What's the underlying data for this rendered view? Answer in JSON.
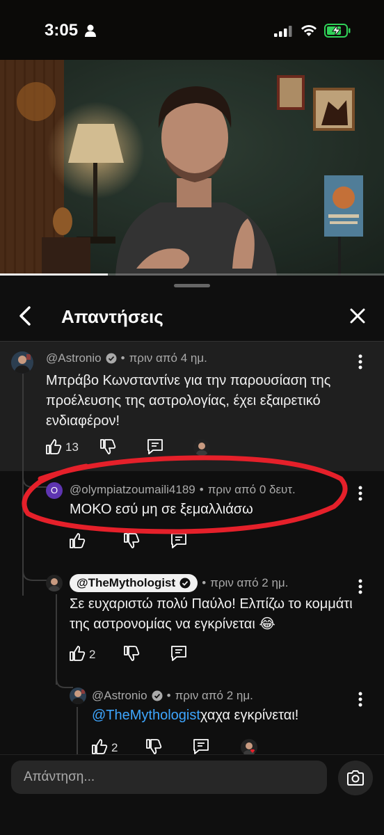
{
  "status_bar": {
    "time": "3:05",
    "icons": [
      "person-icon",
      "signal-icon",
      "wifi-icon",
      "battery-charging-icon"
    ]
  },
  "video": {
    "progress_fraction": 0.28
  },
  "sheet": {
    "title": "Απαντήσεις",
    "back_icon": "chevron-left-icon",
    "close_icon": "close-icon"
  },
  "comments": [
    {
      "handle": "@Astronio",
      "verified": true,
      "time": "πριν από 4 ημ.",
      "lines": [
        "Μπράβο Κωνσταντίνε για την παρουσίαση της",
        "προέλευσης της αστρολογίας, έχει εξαιρετικό",
        "ενδιαφέρον!"
      ],
      "likes": "13"
    },
    {
      "handle": "@olympiatzoumaili4189",
      "avatar_letter": "O",
      "time": "πριν από 0 δευτ.",
      "text": "ΜΟΚΟ εσύ μη σε ξεμαλλιάσω",
      "likes": ""
    },
    {
      "handle": "@TheMythologist",
      "verified": true,
      "creator": true,
      "time": "πριν από 2 ημ.",
      "lines": [
        "Σε ευχαριστώ πολύ Παύλο! Ελπίζω το κομμάτι",
        "της αστρονομίας να εγκρίνεται 😂"
      ],
      "likes": "2"
    },
    {
      "handle": "@Astronio",
      "verified": true,
      "time": "πριν από 2 ημ.",
      "mention": "@TheMythologist",
      "text": "χαχα εγκρίνεται!",
      "likes": "2"
    }
  ],
  "reply_bar": {
    "placeholder": "Απάντηση...",
    "camera_icon": "camera-icon"
  },
  "colors": {
    "background": "#0f0f0f",
    "highlight_bg": "#1f1f1f",
    "mention": "#3ea6ff",
    "annotation": "#e5202a",
    "battery": "#30d158"
  }
}
